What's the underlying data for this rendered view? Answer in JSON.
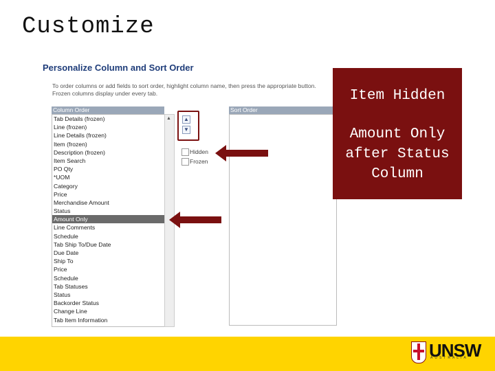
{
  "slide": {
    "title": "Customize"
  },
  "panel": {
    "title": "Personalize Column and Sort Order",
    "instructions": "To order columns or add fields to sort order, highlight column name, then press the appropriate button. Frozen columns display under every tab."
  },
  "column_order": {
    "label": "Column Order",
    "items": [
      "Tab Details (frozen)",
      "Line (frozen)",
      "Line Details (frozen)",
      "Item (frozen)",
      "Description (frozen)",
      "Item Search",
      "PO Qty",
      "*UOM",
      "Category",
      "Price",
      "Merchandise Amount",
      "Status",
      "Amount Only",
      "Line Comments",
      "Schedule",
      "Tab Ship To/Due Date",
      "Due Date",
      "Ship To",
      "Price",
      "Schedule",
      "Tab Statuses",
      "Status",
      "Backorder Status",
      "Change Line",
      "Tab Item Information"
    ],
    "selected": "Amount Only"
  },
  "sort_order": {
    "label": "Sort Order"
  },
  "options": {
    "hidden_label": "Hidden",
    "frozen_label": "Frozen"
  },
  "buttons": {
    "move_up_glyph": "▲",
    "move_down_glyph": "▼"
  },
  "callout": {
    "line1": "Item Hidden",
    "line2a": "Amount Only",
    "line2b": "after Status",
    "line2c": "Column"
  },
  "footer": {
    "logo_text": "UNSW",
    "logo_sub": "AUSTRALIA"
  },
  "colors": {
    "accent": "#7a1010",
    "footer": "#ffd400",
    "selected_row": "#6a6a6a"
  }
}
